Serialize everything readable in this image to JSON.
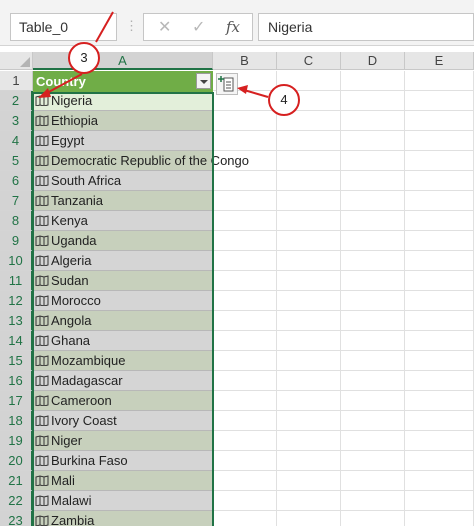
{
  "formula_bar": {
    "name_box": "Table_0",
    "cancel_symbol": "✕",
    "enter_symbol": "✓",
    "fx_label": "fx",
    "value": "Nigeria"
  },
  "columns": [
    "A",
    "B",
    "C",
    "D",
    "E"
  ],
  "table": {
    "header": "Country",
    "rows": [
      {
        "row": "1"
      },
      {
        "row": "2",
        "value": "Nigeria"
      },
      {
        "row": "3",
        "value": "Ethiopia"
      },
      {
        "row": "4",
        "value": "Egypt"
      },
      {
        "row": "5",
        "value": "Democratic Republic of the Congo"
      },
      {
        "row": "6",
        "value": "South Africa"
      },
      {
        "row": "7",
        "value": "Tanzania"
      },
      {
        "row": "8",
        "value": "Kenya"
      },
      {
        "row": "9",
        "value": "Uganda"
      },
      {
        "row": "10",
        "value": "Algeria"
      },
      {
        "row": "11",
        "value": "Sudan"
      },
      {
        "row": "12",
        "value": "Morocco"
      },
      {
        "row": "13",
        "value": "Angola"
      },
      {
        "row": "14",
        "value": "Ghana"
      },
      {
        "row": "15",
        "value": "Mozambique"
      },
      {
        "row": "16",
        "value": "Madagascar"
      },
      {
        "row": "17",
        "value": "Cameroon"
      },
      {
        "row": "18",
        "value": "Ivory Coast"
      },
      {
        "row": "19",
        "value": "Niger"
      },
      {
        "row": "20",
        "value": "Burkina Faso"
      },
      {
        "row": "21",
        "value": "Mali"
      },
      {
        "row": "22",
        "value": "Malawi"
      },
      {
        "row": "23",
        "value": "Zambia"
      }
    ]
  },
  "callouts": {
    "step_3": "3",
    "step_4": "4"
  },
  "colors": {
    "header_green": "#70ad47",
    "selection_green": "#217346",
    "callout_red": "#d62020"
  },
  "icons": {
    "data_type": "map-icon",
    "insert_data": "insert-data-icon",
    "filter": "filter-dropdown-icon"
  }
}
